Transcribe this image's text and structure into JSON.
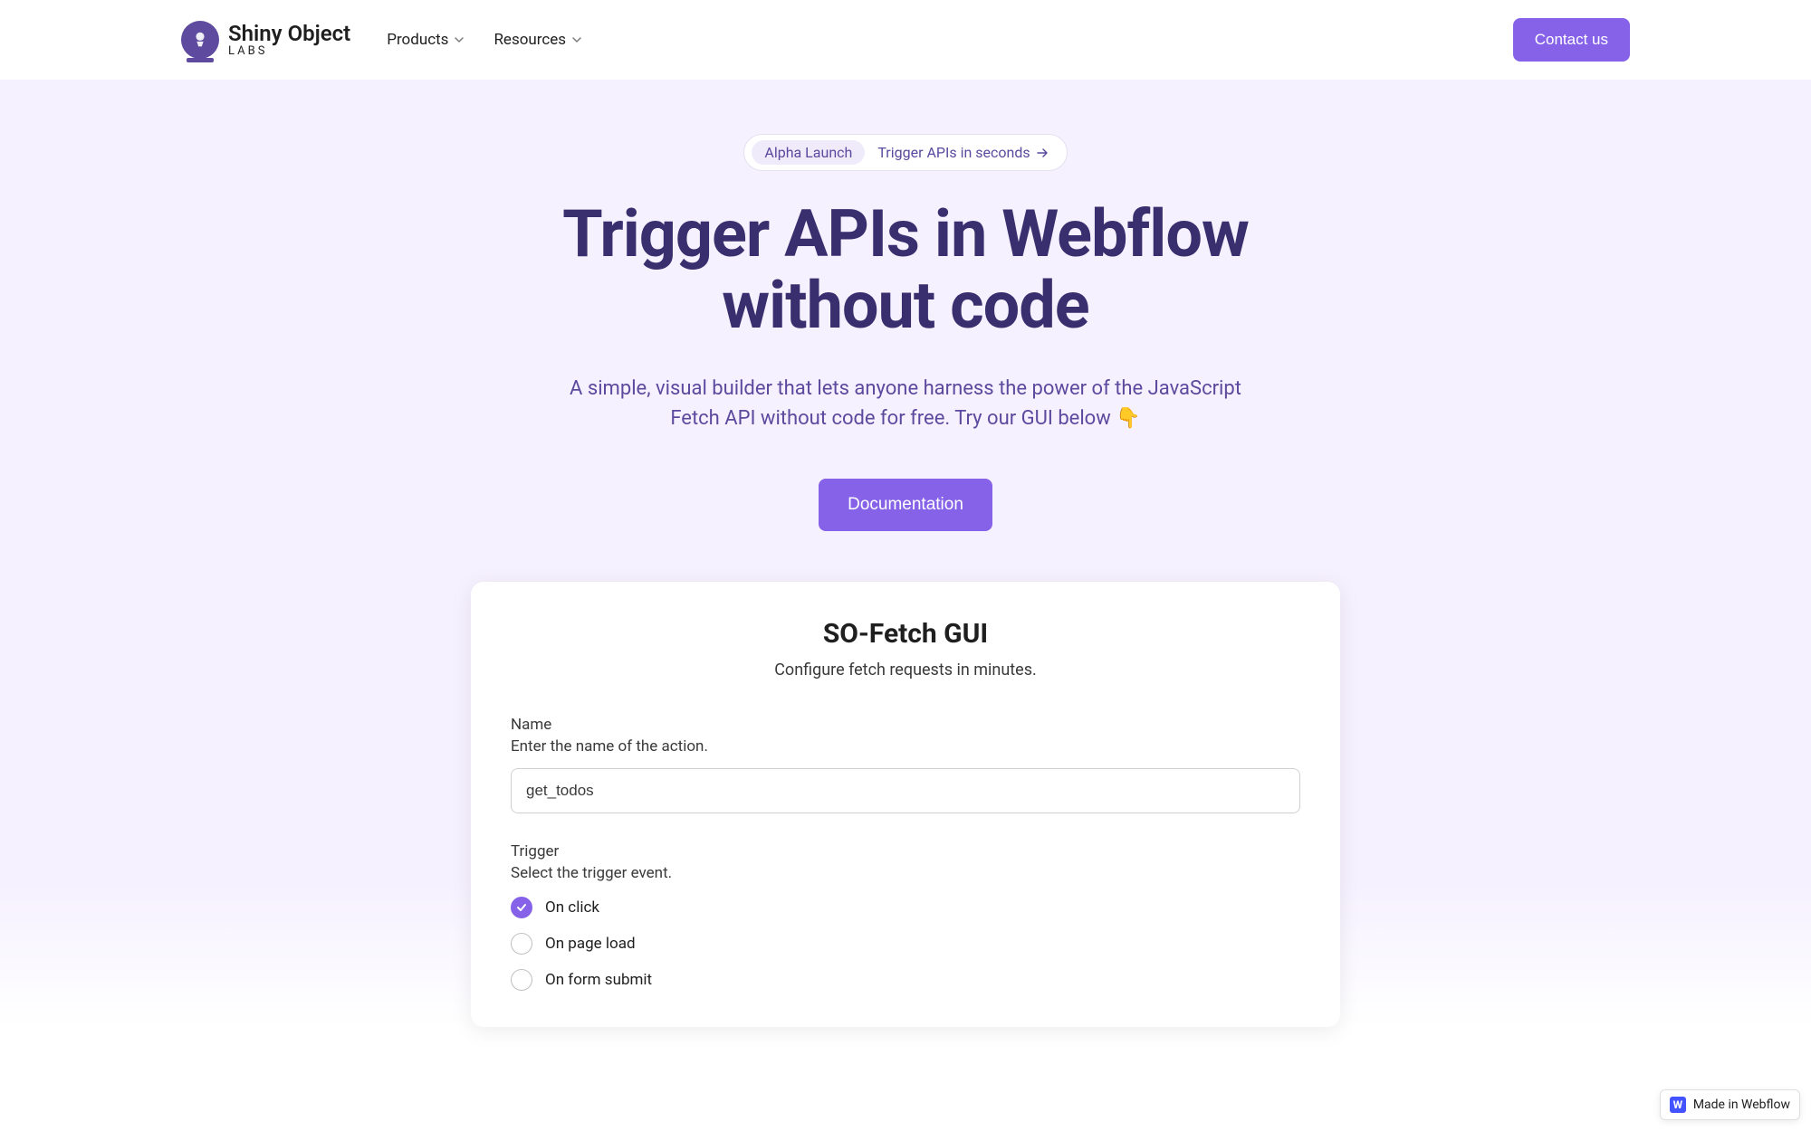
{
  "nav": {
    "logo_title": "Shiny Object",
    "logo_subtitle": "LABS",
    "items": [
      {
        "label": "Products"
      },
      {
        "label": "Resources"
      }
    ],
    "contact_label": "Contact us"
  },
  "hero": {
    "badge_left": "Alpha Launch",
    "badge_right": "Trigger APIs in seconds",
    "title_line1": "Trigger APIs in Webflow",
    "title_line2": "without code",
    "subtitle": "A simple, visual builder that lets anyone harness the power of the JavaScript Fetch API without code for free. Try our GUI below 👇",
    "doc_button": "Documentation"
  },
  "card": {
    "title": "SO-Fetch GUI",
    "subtitle": "Configure fetch requests in minutes.",
    "name_label": "Name",
    "name_help": "Enter the name of the action.",
    "name_value": "get_todos",
    "trigger_label": "Trigger",
    "trigger_help": "Select the trigger event.",
    "radio_options": [
      {
        "label": "On click",
        "checked": true
      },
      {
        "label": "On page load",
        "checked": false
      },
      {
        "label": "On form submit",
        "checked": false
      }
    ]
  },
  "webflow_badge": "Made in Webflow"
}
